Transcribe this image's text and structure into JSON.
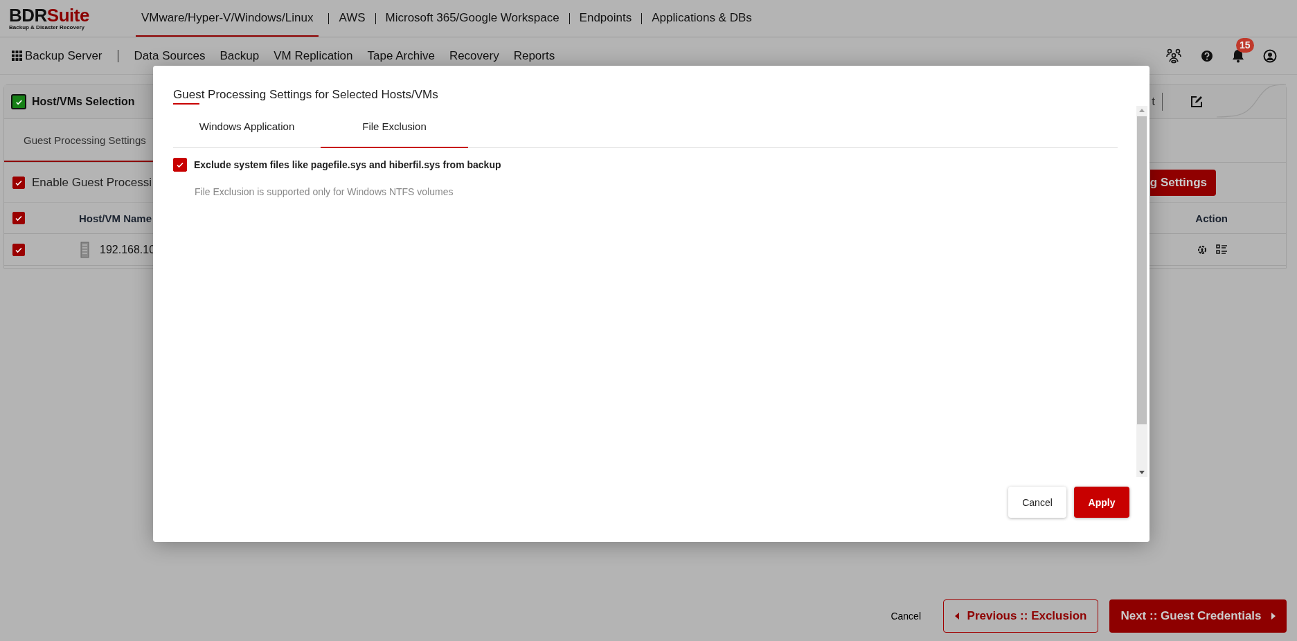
{
  "brand": {
    "name_dark": "BDR",
    "name_accent": "Suite",
    "tagline": "Backup & Disaster Recovery"
  },
  "top_nav": [
    {
      "label": "VMware/Hyper-V/Windows/Linux",
      "selected": true
    },
    {
      "label": "AWS",
      "selected": false
    },
    {
      "label": "Microsoft 365/Google Workspace",
      "selected": false
    },
    {
      "label": "Endpoints",
      "selected": false
    },
    {
      "label": "Applications & DBs",
      "selected": false
    }
  ],
  "sub_nav": {
    "menu_label": "Backup Server",
    "items": [
      "Data Sources",
      "Backup",
      "VM Replication",
      "Tape Archive",
      "Recovery",
      "Reports"
    ]
  },
  "notifications": {
    "count": "15"
  },
  "wizard": {
    "step_title": "Host/VMs Selection",
    "step_done": true,
    "fragment_right": "t",
    "tab": "Guest Processing Settings",
    "enable_label": "Enable Guest Processi",
    "enable_checked": true,
    "settings_button": "g Settings",
    "table": {
      "columns": [
        "Host/VM Name",
        "Action"
      ],
      "all_checked": true,
      "rows": [
        {
          "name": "192.168.10",
          "checked": true
        }
      ]
    }
  },
  "dialog": {
    "title": "Guest Processing Settings for Selected Hosts/VMs",
    "tabs": [
      {
        "label": "Windows Application",
        "selected": false
      },
      {
        "label": "File Exclusion",
        "selected": true
      }
    ],
    "option": {
      "label": "Exclude system files like pagefile.sys and hiberfil.sys from backup",
      "checked": true
    },
    "note": "File Exclusion is supported only for Windows NTFS volumes",
    "buttons": {
      "cancel": "Cancel",
      "apply": "Apply"
    }
  },
  "footer": {
    "cancel": "Cancel",
    "previous": "Previous :: Exclusion",
    "next": "Next :: Guest Credentials"
  }
}
